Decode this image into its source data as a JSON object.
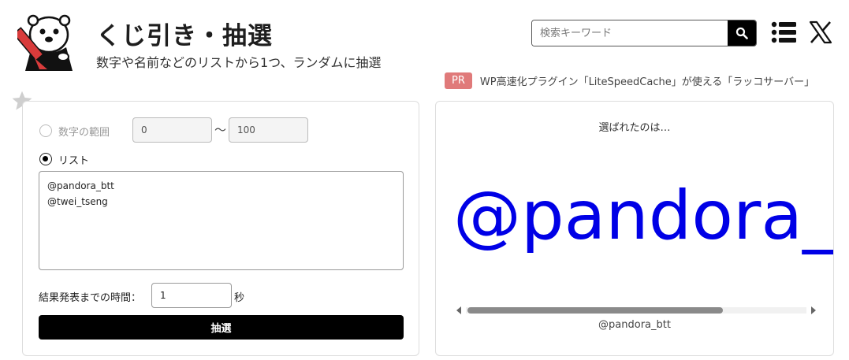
{
  "header": {
    "title": "くじ引き・抽選",
    "subtitle": "数字や名前などのリストから1つ、ランダムに抽選",
    "logo_icon": "sea-otter-pen-icon",
    "search": {
      "placeholder": "検索キーワード",
      "value": ""
    },
    "icons": [
      "search-icon",
      "list-menu-icon",
      "x-logo-icon"
    ]
  },
  "pr": {
    "badge": "PR",
    "text": "WP高速化プラグイン「LiteSpeedCache」が使える「ラッコサーバー」"
  },
  "form": {
    "range_label": "数字の範囲",
    "range_selected": false,
    "range_min": "0",
    "tilde": "〜",
    "range_max": "100",
    "list_label": "リスト",
    "list_selected": true,
    "list_value": "@pandora_btt\n@twei_tseng",
    "time_label": "結果発表までの時間：",
    "time_value": "1",
    "time_unit": "秒",
    "draw_button": "抽選"
  },
  "result": {
    "heading": "選ばれたのは…",
    "big_text": "@pandora_",
    "full_text": "@pandora_btt"
  },
  "colors": {
    "result_blue": "#0000e6",
    "pr_badge": "#e07a7a",
    "button_black": "#000000"
  }
}
